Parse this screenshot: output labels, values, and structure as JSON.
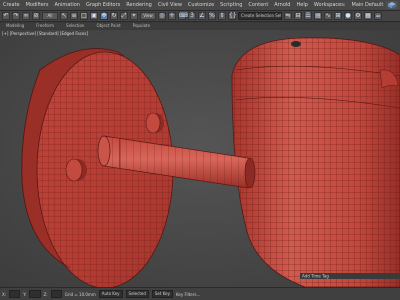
{
  "menubar": {
    "items": [
      "Create",
      "Modifiers",
      "Animation",
      "Graph Editors",
      "Rendering",
      "Civil View",
      "Customize",
      "Scripting",
      "Content",
      "Arnold",
      "Help",
      "Workspaces:",
      "Main Default"
    ],
    "right_icon": "cube-icon"
  },
  "toolbar": {
    "undo_icon": "undo-icon",
    "redo_icon": "redo-icon",
    "link_icon": "link-icon",
    "select_icon": "select-arrow-icon",
    "filter_value": "All",
    "move_icon": "move-icon",
    "rotate_icon": "rotate-icon",
    "scale_icon": "scale-icon",
    "view_value": "View",
    "selection_set_placeholder": "Create Selection Set"
  },
  "ribbon": {
    "tabs": [
      "Modeling",
      "Freeform",
      "Selection",
      "Object Paint",
      "Populate"
    ]
  },
  "viewport": {
    "label": "[+] [Perspective] [Standard] [Edged Faces]",
    "model_color": "#c8473e",
    "wire_color": "#6a1a16",
    "background_color": "#474747"
  },
  "timebar": {
    "label": "Add Time Tag"
  },
  "statusbar": {
    "x_label": "X:",
    "y_label": "Y:",
    "z_label": "Z:",
    "grid_label": "Grid = 10.0mm",
    "auto_key": "Auto Key",
    "selected": "Selected",
    "set_key": "Set Key",
    "key_filters": "Key Filters..."
  },
  "colors": {
    "accent": "#5d7ea6",
    "ui_bg": "#444444"
  }
}
